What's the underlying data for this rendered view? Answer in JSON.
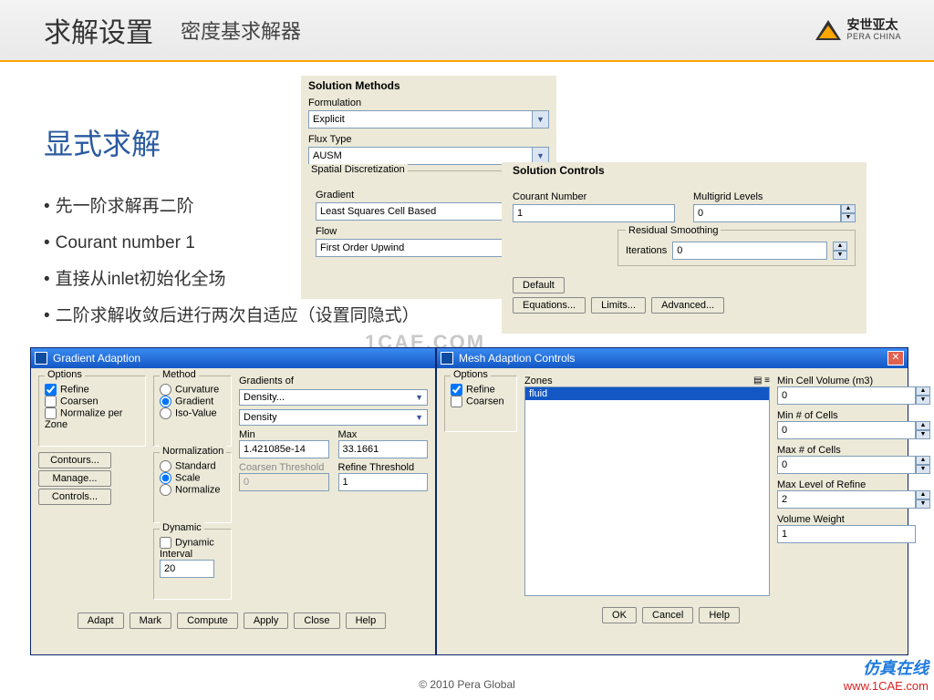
{
  "header": {
    "title_main": "求解设置",
    "title_sub": "密度基求解器",
    "logo_cn": "安世亚太",
    "logo_en": "PERA CHINA"
  },
  "left": {
    "heading": "显式求解",
    "bullets": [
      "先一阶求解再二阶",
      "Courant number 1",
      "直接从inlet初始化全场",
      "二阶求解收敛后进行两次自适应（设置同隐式）"
    ]
  },
  "methods": {
    "title": "Solution Methods",
    "formulation_label": "Formulation",
    "formulation_value": "Explicit",
    "flux_label": "Flux Type",
    "flux_value": "AUSM",
    "spatial_label": "Spatial Discretization",
    "gradient_label": "Gradient",
    "gradient_value": "Least Squares Cell Based",
    "flow_label": "Flow",
    "flow_value": "First Order Upwind"
  },
  "controls": {
    "title": "Solution Controls",
    "courant_label": "Courant Number",
    "courant_value": "1",
    "multigrid_label": "Multigrid Levels",
    "multigrid_value": "0",
    "residual_title": "Residual Smoothing",
    "iterations_label": "Iterations",
    "iterations_value": "0",
    "default_btn": "Default",
    "equations_btn": "Equations...",
    "limits_btn": "Limits...",
    "advanced_btn": "Advanced..."
  },
  "grad": {
    "window_title": "Gradient Adaption",
    "options_title": "Options",
    "opt_refine": "Refine",
    "opt_coarsen": "Coarsen",
    "opt_norm_zone": "Normalize per Zone",
    "method_title": "Method",
    "m_curv": "Curvature",
    "m_grad": "Gradient",
    "m_iso": "Iso-Value",
    "gradients_of_title": "Gradients of",
    "gof_primary": "Density...",
    "gof_secondary": "Density",
    "min_label": "Min",
    "min_value": "1.421085e-14",
    "max_label": "Max",
    "max_value": "33.1661",
    "coarsen_th_label": "Coarsen Threshold",
    "coarsen_th_value": "0",
    "refine_th_label": "Refine Threshold",
    "refine_th_value": "1",
    "norm_title": "Normalization",
    "n_standard": "Standard",
    "n_scale": "Scale",
    "n_normalize": "Normalize",
    "dynamic_title": "Dynamic",
    "dynamic_cb": "Dynamic",
    "interval_label": "Interval",
    "interval_value": "20",
    "contours_btn": "Contours...",
    "manage_btn": "Manage...",
    "controls_btn": "Controls...",
    "adapt_btn": "Adapt",
    "mark_btn": "Mark",
    "compute_btn": "Compute",
    "apply_btn": "Apply",
    "close_btn": "Close",
    "help_btn": "Help"
  },
  "mesh": {
    "window_title": "Mesh Adaption Controls",
    "options_title": "Options",
    "opt_refine": "Refine",
    "opt_coarsen": "Coarsen",
    "zones_title": "Zones",
    "zone_item": "fluid",
    "mincell_label": "Min Cell Volume (m3)",
    "mincell_value": "0",
    "minnum_label": "Min # of Cells",
    "minnum_value": "0",
    "maxnum_label": "Max # of Cells",
    "maxnum_value": "0",
    "maxlevel_label": "Max Level of Refine",
    "maxlevel_value": "2",
    "volw_label": "Volume Weight",
    "volw_value": "1",
    "ok_btn": "OK",
    "cancel_btn": "Cancel",
    "help_btn": "Help"
  },
  "footer": {
    "copyright": "© 2010 Pera Global",
    "wm_cn": "仿真在线",
    "wm_url": "www.1CAE.com",
    "faint_wm": "1CAE.COM"
  }
}
